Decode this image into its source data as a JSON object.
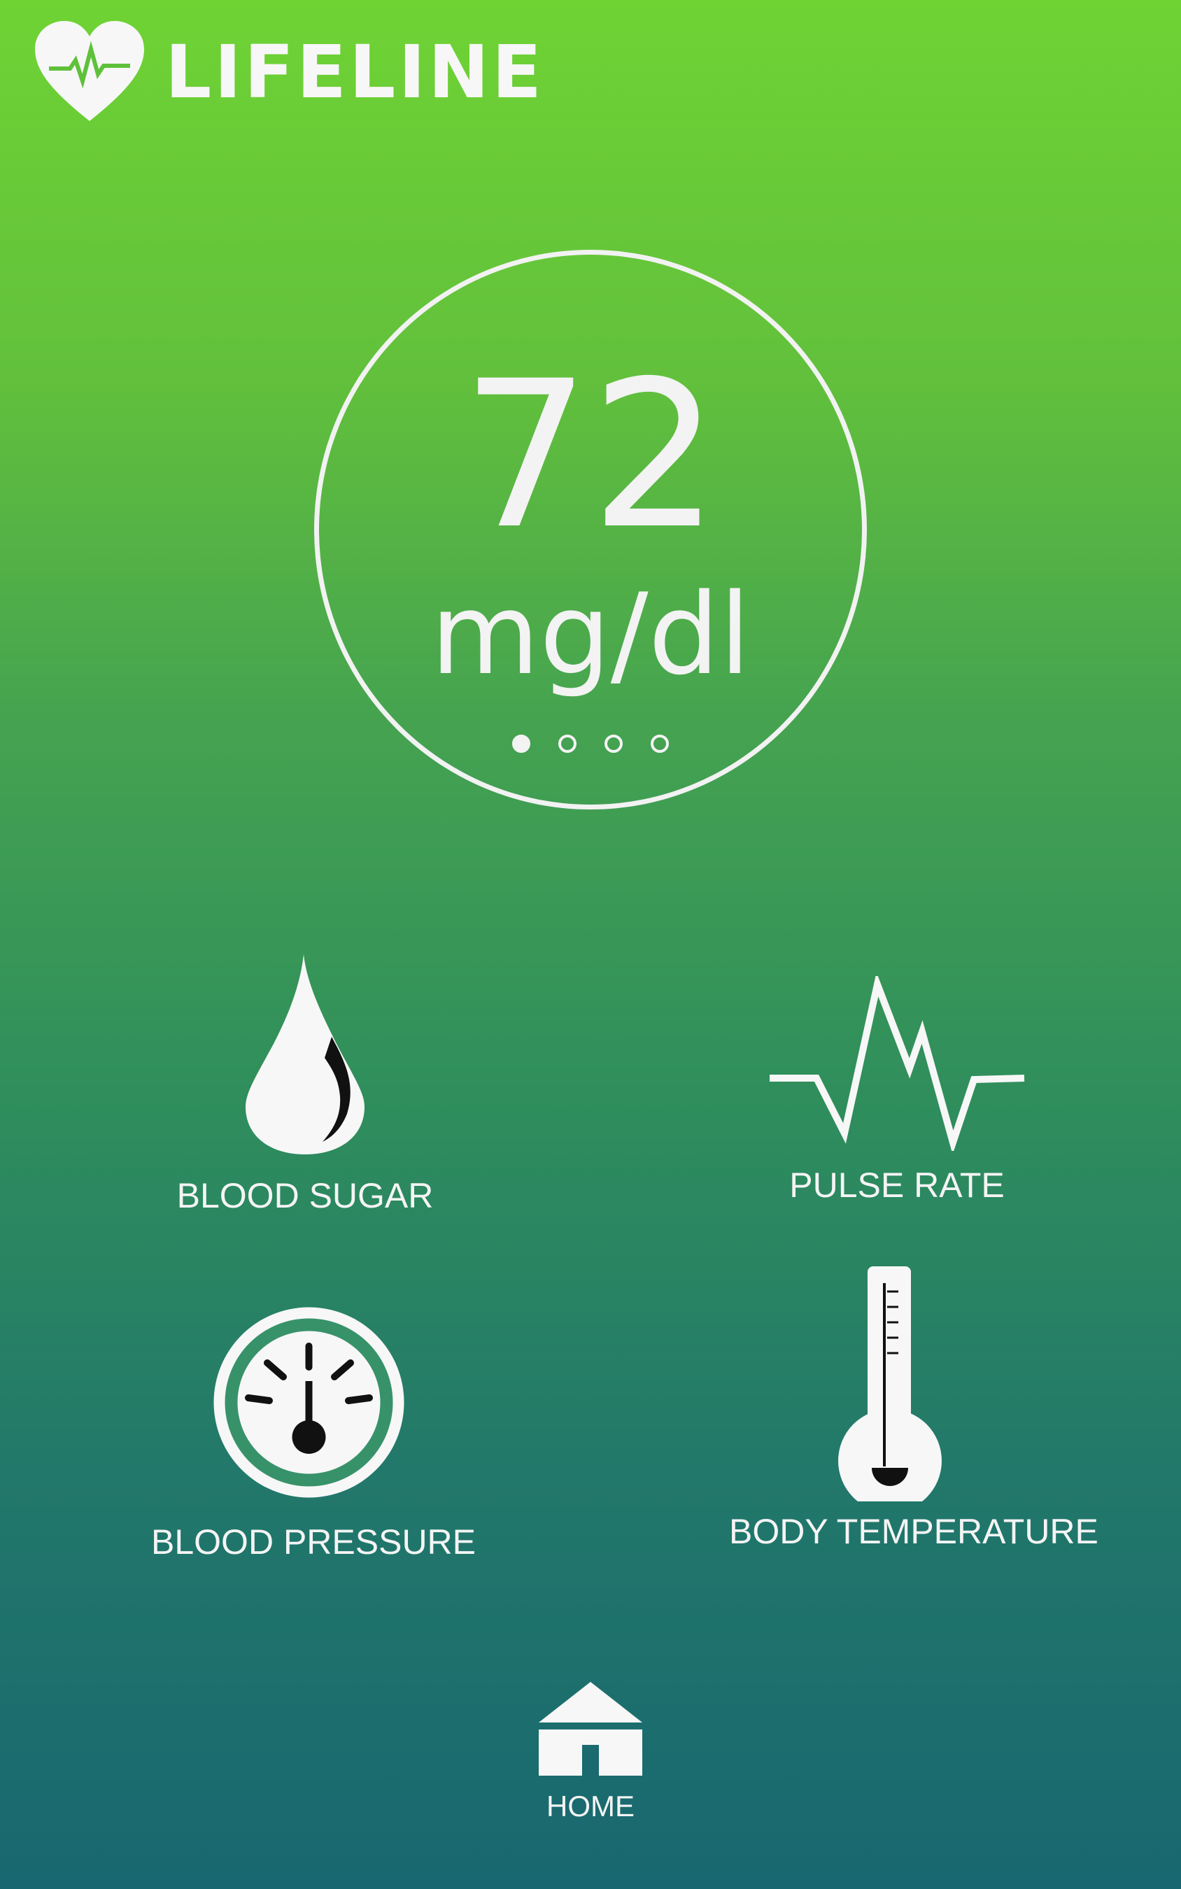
{
  "app": {
    "title": "LIFELINE",
    "logo_icon": "heart-pulse-icon"
  },
  "reading": {
    "value": "72",
    "unit": "mg/dl",
    "pager": {
      "total": 4,
      "active": 0
    }
  },
  "tiles": [
    {
      "label": "BLOOD SUGAR",
      "icon": "water-drop-icon"
    },
    {
      "label": "PULSE RATE",
      "icon": "pulse-wave-icon"
    },
    {
      "label": "BLOOD PRESSURE",
      "icon": "gauge-icon"
    },
    {
      "label": "BODY TEMPERATURE",
      "icon": "thermometer-icon"
    }
  ],
  "nav": {
    "home_label": "HOME",
    "home_icon": "home-icon"
  },
  "colors": {
    "gradient_top": "#6fd334",
    "gradient_bottom": "#186770",
    "foreground": "#f4f4f4"
  }
}
